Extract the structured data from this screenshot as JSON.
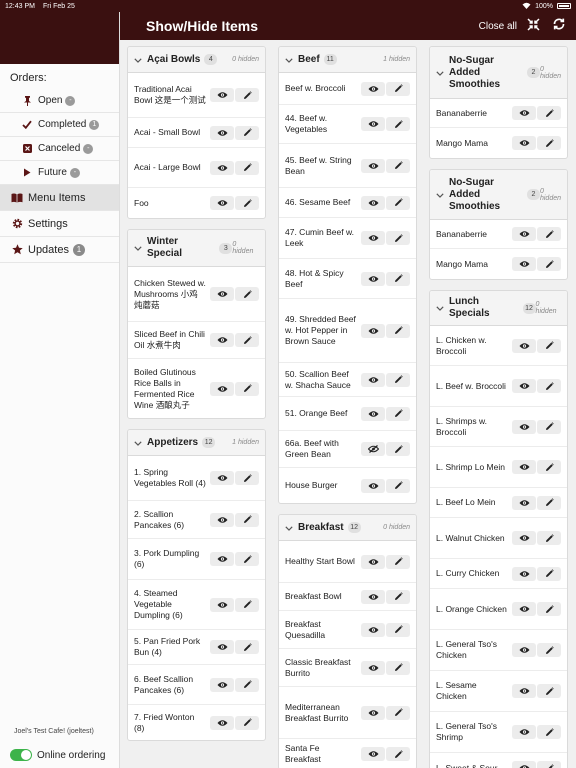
{
  "status": {
    "time": "12:43 PM",
    "date": "Fri Feb 25",
    "battery": "100%"
  },
  "header": {
    "title": "Show/Hide Items",
    "close_all": "Close all"
  },
  "sidebar": {
    "orders_title": "Orders:",
    "orders": [
      {
        "label": "Open",
        "badge": "-",
        "icon": "pin-icon"
      },
      {
        "label": "Completed",
        "badge": "1",
        "icon": "checkmark-icon"
      },
      {
        "label": "Canceled",
        "badge": "-",
        "icon": "cancel-box-icon"
      },
      {
        "label": "Future",
        "badge": "-",
        "icon": "play-icon"
      }
    ],
    "menu_items": "Menu Items",
    "settings": "Settings",
    "updates": "Updates",
    "updates_badge": "1",
    "cafe": "Joel's Test Cafe! (joeltest)",
    "online_ordering": "Online ordering"
  },
  "columns": [
    [
      {
        "name": "Açai Bowls",
        "count": "4",
        "hidden": "0 hidden",
        "items": [
          "Traditional Acai Bowl 这是一个测试",
          "Acai - Small Bowl",
          "Acai - Large Bowl",
          "Foo"
        ]
      },
      {
        "name": "Winter Special",
        "count": "3",
        "hidden": "0 hidden",
        "items": [
          "Chicken Stewed w. Mushrooms 小鸡炖蘑菇",
          "Sliced Beef in Chili Oil 水煮牛肉",
          "Boiled Glutinous Rice Balls in Fermented Rice Wine 酒酿丸子"
        ]
      },
      {
        "name": "Appetizers",
        "count": "12",
        "hidden": "1 hidden",
        "items": [
          "1. Spring Vegetables Roll (4)",
          "2. Scallion Pancakes (6)",
          "3. Pork Dumpling (6)",
          "4. Steamed Vegetable Dumpling (6)",
          "5. Pan Fried Pork Bun (4)",
          "6. Beef Scallion Pancakes (6)",
          "7. Fried Wonton (8)"
        ]
      }
    ],
    [
      {
        "name": "Beef",
        "count": "11",
        "hidden": "1 hidden",
        "items": [
          "Beef w. Broccoli",
          "44. Beef w. Vegetables",
          "45. Beef w. String Bean",
          "46. Sesame Beef",
          "47. Cumin Beef w. Leek",
          "48. Hot & Spicy Beef",
          "49. Shredded Beef w. Hot Pepper in Brown Sauce",
          "50. Scallion Beef w. Shacha Sauce",
          "51. Orange Beef",
          "66a. Beef with Green Bean",
          "House Burger"
        ],
        "hidden_index": 9
      },
      {
        "name": "Breakfast",
        "count": "12",
        "hidden": "0 hidden",
        "items": [
          "Healthy Start Bowl",
          "Breakfast Bowl",
          "Breakfast Quesadilla",
          "Classic Breakfast Burrito",
          "Mediterranean Breakfast Burrito",
          "Santa Fe Breakfast"
        ]
      }
    ],
    [
      {
        "name": "No-Sugar Added Smoothies",
        "count": "2",
        "hidden": "0 hidden",
        "items": [
          "Bananaberrie",
          "Mango Mama"
        ]
      },
      {
        "name": "No-Sugar Added Smoothies",
        "count": "2",
        "hidden": "0 hidden",
        "items": [
          "Bananaberrie",
          "Mango Mama"
        ]
      },
      {
        "name": "Lunch Specials",
        "count": "12",
        "hidden": "0 hidden",
        "items": [
          "L. Chicken w. Broccoli",
          "L. Beef w. Broccoli",
          "L. Shrimps w. Broccoli",
          "L. Shrimp Lo Mein",
          "L. Beef Lo Mein",
          "L. Walnut Chicken",
          "L. Curry Chicken",
          "L. Orange Chicken",
          "L. General Tso's Chicken",
          "L. Sesame Chicken",
          "L. General Tso's Shrimp",
          "L. Sweet & Sour"
        ]
      }
    ]
  ]
}
